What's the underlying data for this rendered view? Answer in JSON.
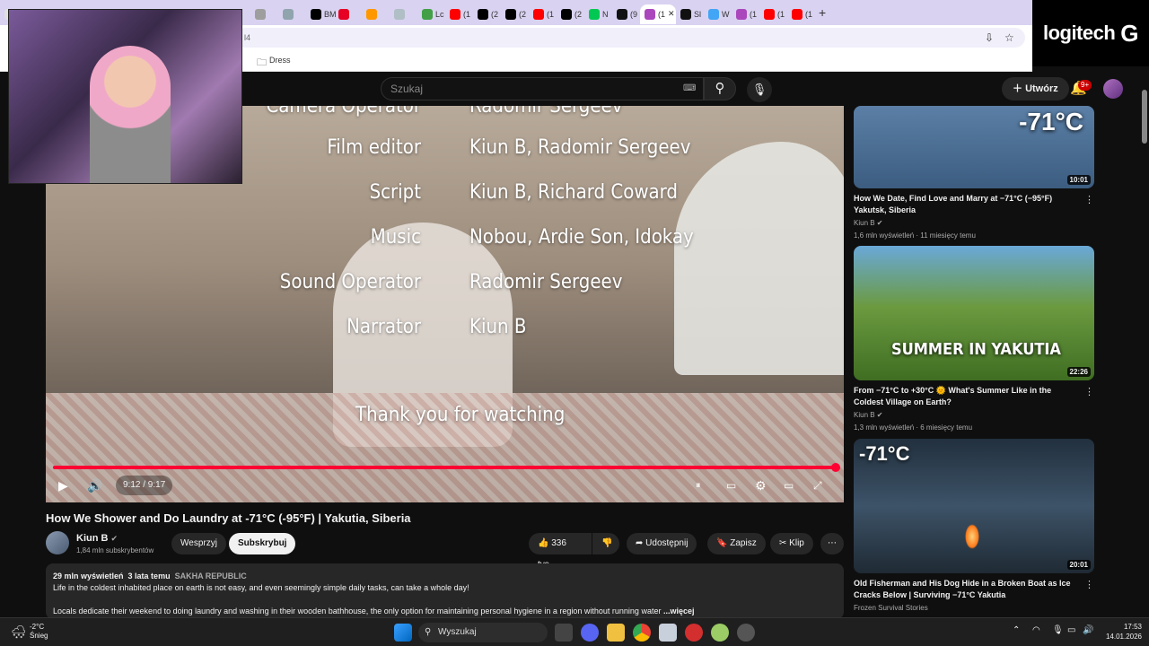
{
  "browser": {
    "address_text": "l4",
    "bookmark_folder": "Dress",
    "tabs": [
      {
        "label": "",
        "color": "#e0e0e0"
      },
      {
        "label": "",
        "color": "#ffd54f"
      },
      {
        "label": "",
        "color": "#4caf50"
      },
      {
        "label": "",
        "color": "#e91e63"
      },
      {
        "label": "",
        "color": "#333333"
      },
      {
        "label": "",
        "color": "#1877f2"
      },
      {
        "label": "",
        "color": "#c2185b"
      },
      {
        "label": "",
        "color": "#d32f2f"
      },
      {
        "label": "",
        "color": "#7e57c2"
      },
      {
        "label": "",
        "color": "#9e9e9e"
      },
      {
        "label": "",
        "color": "#90a4ae"
      },
      {
        "label": "BM",
        "color": "#000000"
      },
      {
        "label": "",
        "color": "#e60023"
      },
      {
        "label": "",
        "color": "#ff9800"
      },
      {
        "label": "",
        "color": "#b0bec5"
      },
      {
        "label": "Lc",
        "color": "#43a047"
      },
      {
        "label": "(1",
        "color": "#ff0000"
      },
      {
        "label": "(2",
        "color": "#000000"
      },
      {
        "label": "(2",
        "color": "#000000"
      },
      {
        "label": "(1",
        "color": "#ff0000"
      },
      {
        "label": "(2",
        "color": "#000000"
      },
      {
        "label": "N",
        "color": "#00c853"
      },
      {
        "label": "(9",
        "color": "#111111"
      },
      {
        "label": "(1",
        "color": "#ab47bc",
        "active": true
      },
      {
        "label": "Sl",
        "color": "#111111"
      },
      {
        "label": "W",
        "color": "#42a5f5"
      },
      {
        "label": "(1",
        "color": "#ab47bc"
      },
      {
        "label": "(1",
        "color": "#ff0000"
      },
      {
        "label": "(1",
        "color": "#ff0000"
      }
    ]
  },
  "logo": {
    "text": "logitech",
    "mark": "G"
  },
  "youtube": {
    "search_placeholder": "Szukaj",
    "create_label": "Utwórz",
    "notifications": "9+"
  },
  "player": {
    "credits": [
      {
        "role": "Camera Operator",
        "name": "Radomir Sergeev"
      },
      {
        "role": "Film editor",
        "name": "Kiun B, Radomir Sergeev"
      },
      {
        "role": "Script",
        "name": "Kiun B, Richard Coward"
      },
      {
        "role": "Music",
        "name": "Nobou, Ardie Son, Idokay"
      },
      {
        "role": "Sound Operator",
        "name": "Radomir Sergeev"
      },
      {
        "role": "Narrator",
        "name": "Kiun B"
      }
    ],
    "thanks": "Thank you for watching",
    "time": "9:12 / 9:17",
    "progress": 0.99
  },
  "video": {
    "title": "How We Shower and Do Laundry at -71°C (-95°F) | Yakutia, Siberia",
    "channel": "Kiun B",
    "subscribers": "1,84 mln subskrybentów",
    "support_label": "Wesprzyj",
    "subscribe_label": "Subskrybuj",
    "likes": "336 tys.",
    "share_label": "Udostępnij",
    "save_label": "Zapisz",
    "clip_label": "Klip",
    "views": "29 mln wyświetleń",
    "age": "3 lata temu",
    "location": "SAKHA REPUBLIC",
    "desc_line1": "Life in the coldest inhabited place on earth is not easy, and even seemingly simple daily tasks, can take a whole day!",
    "desc_line2": "Locals dedicate their weekend to doing laundry and washing in their wooden bathhouse, the only option for maintaining personal hygiene in a region without running water",
    "more_label": "...więcej"
  },
  "recommendations": [
    {
      "overlay": "-71°C",
      "duration": "10:01",
      "title": "How We Date, Find Love and Marry at −71°C (−95°F) Yakutsk, Siberia",
      "channel": "Kiun B",
      "meta": "1,6 mln wyświetleń · 11 miesięcy temu"
    },
    {
      "overlay": "SUMMER IN YAKUTIA",
      "duration": "22:26",
      "title": "From −71°C to +30°C 🌞 What's Summer Like in the Coldest Village on Earth?",
      "channel": "Kiun B",
      "meta": "1,3 mln wyświetleń · 6 miesięcy temu"
    },
    {
      "overlay": "-71°C",
      "duration": "20:01",
      "title": "Old Fisherman and His Dog Hide in a Broken Boat as Ice Cracks Below | Surviving −71°C Yakutia",
      "channel": "Frozen Survival Stories",
      "meta": ""
    }
  ],
  "taskbar": {
    "temp": "-2°C",
    "weather": "Śnieg",
    "search": "Wyszukaj",
    "time": "17:53",
    "date": "14.01.2026"
  }
}
